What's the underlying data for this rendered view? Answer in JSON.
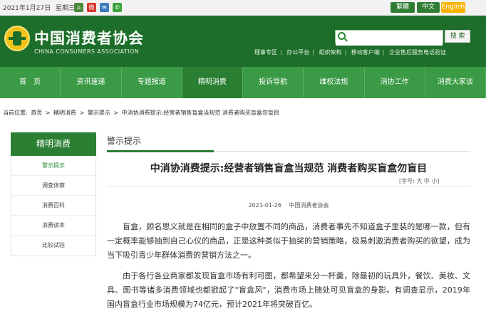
{
  "topbar": {
    "date": "2021年1月27日",
    "weekday": "星期三",
    "social": [
      {
        "icon": "home-icon",
        "glyph": "⌂",
        "color": "#4a8a3a"
      },
      {
        "icon": "weibo-icon",
        "glyph": "微",
        "color": "#d9342b"
      },
      {
        "icon": "mail-icon",
        "glyph": "✉",
        "color": "#3b7bbf"
      },
      {
        "icon": "wechat-icon",
        "glyph": "✆",
        "color": "#3aa53a"
      }
    ],
    "lang_traditional": "繁體",
    "lang_chinese": "中文",
    "lang_english": "English"
  },
  "header": {
    "title": "中国消费者协会",
    "subtitle": "CHINA CONSUMERS ASSOCIATION",
    "search_placeholder": "",
    "search_button": "搜 索",
    "quicklinks": [
      "理事专区",
      "办公平台",
      "组织架构",
      "移动客户端",
      "企业售后服务电话验证"
    ]
  },
  "nav": [
    {
      "label": "首　页"
    },
    {
      "label": "资讯速递"
    },
    {
      "label": "专题报道"
    },
    {
      "label": "精明消费",
      "active": true
    },
    {
      "label": "投诉导航"
    },
    {
      "label": "维权法规"
    },
    {
      "label": "消协工作"
    },
    {
      "label": "消费大家谈"
    }
  ],
  "breadcrumb": {
    "prefix": "当前位置:",
    "items": [
      "首页",
      "精明消费",
      "警示提示",
      "中消协消费提示:经营者销售盲盒当规范 消费者购买盲盒勿盲目"
    ],
    "sep": ">"
  },
  "sidebar": {
    "title": "精明消费",
    "items": [
      {
        "label": "警示提示",
        "active": true
      },
      {
        "label": "调查体察"
      },
      {
        "label": "消费百科"
      },
      {
        "label": "消费读本"
      },
      {
        "label": "比较试验"
      }
    ]
  },
  "main": {
    "section_title": "警示提示",
    "article_title": "中消协消费提示:经营者销售盲盒当规范 消费者购买盲盒勿盲目",
    "font_size_label": "[字号: 大 中 小]",
    "publish_date": "2021-01-26",
    "publisher": "中国消费者协会",
    "paragraphs": [
      "盲盒，顾名思义就是在相同的盒子中放置不同的商品，消费者事先不知道盒子里装的是哪一款，但有一定概率能够抽到自己心仪的商品，正是这种类似于抽奖的营销策略，极易刺激消费者购买的欲望，成为当下吸引青少年群体消费的营销方法之一。",
      "由于各行各业商家都发现盲盒市场有利可图，都希望来分一杯羹，除最初的玩具外，餐饮、美妆、文具、图书等诸多消费领域也都掀起了\"盲盒风\"，消费市场上随处可见盲盒的身影。有调查显示，2019年国内盲盒行业市场规模为74亿元，预计2021年将突破百亿。"
    ]
  }
}
